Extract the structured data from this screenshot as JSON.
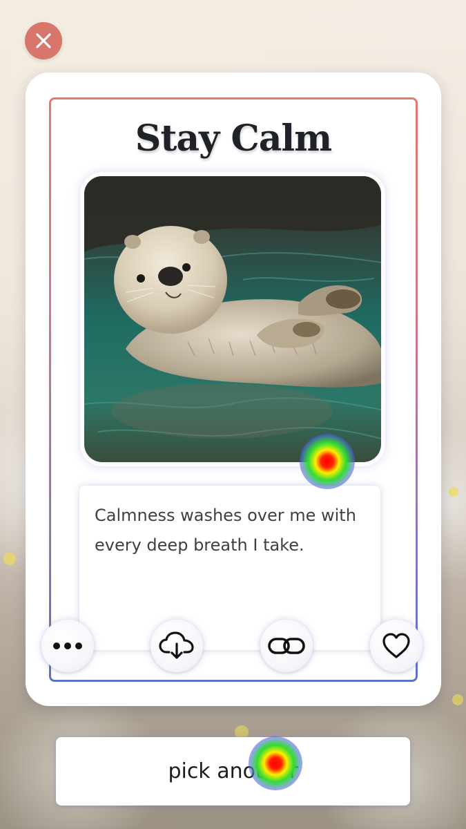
{
  "card": {
    "title": "Stay Calm",
    "image_alt": "sea otter floating on its back in water",
    "quote": "Calmness washes over me with every deep breath I take."
  },
  "actions": {
    "close_icon": "close-icon",
    "more_icon": "more-icon",
    "download_icon": "cloud-download-icon",
    "link_icon": "link-icon",
    "like_icon": "heart-icon"
  },
  "footer": {
    "pick_label": "pick another"
  },
  "colors": {
    "close_bg": "#d9766b",
    "frame_top": "#e07a6c",
    "frame_bottom": "#5b72c9",
    "title": "#1f2329",
    "quote_text": "#3d4144"
  }
}
